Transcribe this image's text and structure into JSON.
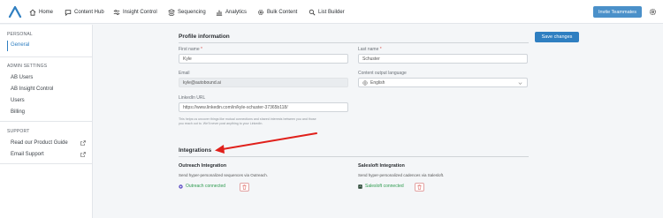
{
  "nav": {
    "items": [
      {
        "label": "Home",
        "icon": "home-icon"
      },
      {
        "label": "Content Hub",
        "icon": "chat-bubble-icon"
      },
      {
        "label": "Insight Control",
        "icon": "sliders-icon"
      },
      {
        "label": "Sequencing",
        "icon": "stack-icon"
      },
      {
        "label": "Analytics",
        "icon": "chart-icon"
      },
      {
        "label": "Bulk Content",
        "icon": "gear-icon"
      },
      {
        "label": "List Builder",
        "icon": "search-icon"
      }
    ],
    "invite_label": "Invite Teammates"
  },
  "sidebar": {
    "personal_heading": "PERSONAL",
    "general_label": "General",
    "admin_heading": "ADMIN SETTINGS",
    "admin_items": [
      "AB Users",
      "AB Insight Control",
      "Users",
      "Billing"
    ],
    "support_heading": "SUPPORT",
    "support_items": [
      "Read our Product Guide",
      "Email Support"
    ]
  },
  "profile": {
    "heading": "Profile information",
    "save_label": "Save changes",
    "first_name_label": "First name",
    "first_name_value": "Kyle",
    "last_name_label": "Last name",
    "last_name_value": "Schuster",
    "email_label": "Email",
    "email_value": "kyle@autobound.ai",
    "language_label": "Content output language",
    "language_value": "English",
    "linkedin_label": "LinkedIn URL",
    "linkedin_value": "https://www.linkedin.com/in/kyle-schuster-37365b118/",
    "help_line1": "This helps us uncover things like mutual connections and shared interests between you and those",
    "help_line2": "you reach out to. We'll never post anything to your LinkedIn.",
    "required_mark": "*"
  },
  "integrations": {
    "heading": "Integrations",
    "outreach": {
      "title": "Outreach Integration",
      "desc": "Send hyper-personalized sequences via Outreach.",
      "status": "Outreach connected"
    },
    "salesloft": {
      "title": "Salesloft Integration",
      "desc": "Send hyper-personalized cadences via Salesloft.",
      "status": "Salesloft connected"
    }
  },
  "colors": {
    "accent": "#2f7fc1",
    "connected": "#2e9b4f",
    "annotation_arrow": "#e0201b"
  }
}
